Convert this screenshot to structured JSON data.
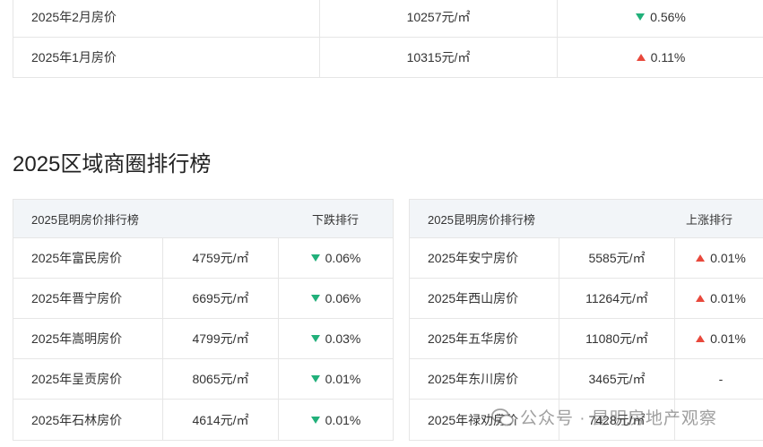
{
  "top_table": {
    "rows": [
      {
        "label": "2025年2月房价",
        "price": "10257元/㎡",
        "change": "0.56%",
        "dir": "down"
      },
      {
        "label": "2025年1月房价",
        "price": "10315元/㎡",
        "change": "0.11%",
        "dir": "up"
      }
    ]
  },
  "section": {
    "title": "2025区域商圈排行榜"
  },
  "left_table": {
    "header_title": "2025昆明房价排行榜",
    "header_rank": "下跌排行",
    "rows": [
      {
        "area": "2025年富民房价",
        "price": "4759元/㎡",
        "change": "0.06%",
        "dir": "down"
      },
      {
        "area": "2025年晋宁房价",
        "price": "6695元/㎡",
        "change": "0.06%",
        "dir": "down"
      },
      {
        "area": "2025年嵩明房价",
        "price": "4799元/㎡",
        "change": "0.03%",
        "dir": "down"
      },
      {
        "area": "2025年呈贡房价",
        "price": "8065元/㎡",
        "change": "0.01%",
        "dir": "down"
      },
      {
        "area": "2025年石林房价",
        "price": "4614元/㎡",
        "change": "0.01%",
        "dir": "down"
      }
    ]
  },
  "right_table": {
    "header_title": "2025昆明房价排行榜",
    "header_rank": "上涨排行",
    "rows": [
      {
        "area": "2025年安宁房价",
        "price": "5585元/㎡",
        "change": "0.01%",
        "dir": "up"
      },
      {
        "area": "2025年西山房价",
        "price": "11264元/㎡",
        "change": "0.01%",
        "dir": "up"
      },
      {
        "area": "2025年五华房价",
        "price": "11080元/㎡",
        "change": "0.01%",
        "dir": "up"
      },
      {
        "area": "2025年东川房价",
        "price": "3465元/㎡",
        "change": "-",
        "dir": "none"
      },
      {
        "area": "2025年禄劝房价",
        "price": "7428元/㎡",
        "change": "",
        "dir": "none"
      }
    ]
  },
  "watermark": {
    "text": "公众号 · 昆明房地产观察"
  },
  "colors": {
    "down": "#21b07a",
    "up": "#e8483b",
    "header_bg": "#f2f5f8",
    "border": "#e6e6e6"
  }
}
